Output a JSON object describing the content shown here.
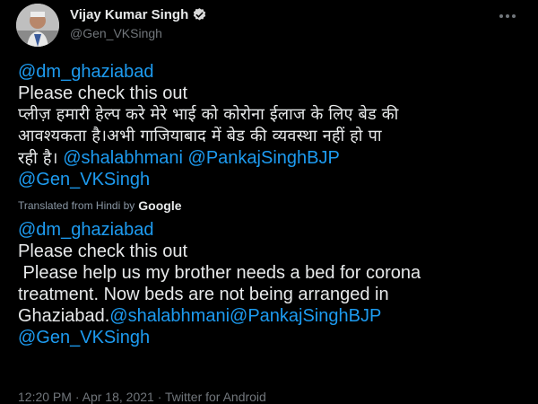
{
  "author": {
    "display_name": "Vijay Kumar Singh",
    "handle": "@Gen_VKSingh",
    "verified_icon": "verified-badge-icon",
    "avatar": "profile-photo"
  },
  "menu_icon": "more-options-icon",
  "original": {
    "mention_top": "@dm_ghaziabad",
    "line1": "Please check this out",
    "hindi_line1": "प्लीज़ हमारी हेल्प करे मेरे भाई को कोरोना ईलाज के लिए बेड की",
    "hindi_line2": "आवश्यकता है।अभी गाजियाबाद में बेड की व्यवस्था नहीं हो पा",
    "hindi_line3": "रही है।",
    "mention_a": "@shalabhmani",
    "mention_b": "@PankajSinghBJP",
    "mention_c": "@Gen_VKSingh"
  },
  "translation_notice": {
    "text": "Translated from Hindi by",
    "provider": "Google"
  },
  "translated": {
    "mention_top": "@dm_ghaziabad",
    "line1": "Please check this out",
    "line2": " Please help us my brother needs a bed for corona",
    "line3": "treatment. Now beds are not being arranged in",
    "line4_prefix": "Ghaziabad.",
    "mention_a": "@shalabhmani",
    "mention_b": "@PankajSinghBJP",
    "mention_c": "@Gen_VKSingh"
  },
  "meta": {
    "time": "12:20 PM",
    "date": "Apr 18, 2021",
    "source": "Twitter for Android",
    "separator": "·"
  },
  "colors": {
    "background": "#000000",
    "link": "#1d9bf0",
    "verified": "#d9d9d9"
  }
}
